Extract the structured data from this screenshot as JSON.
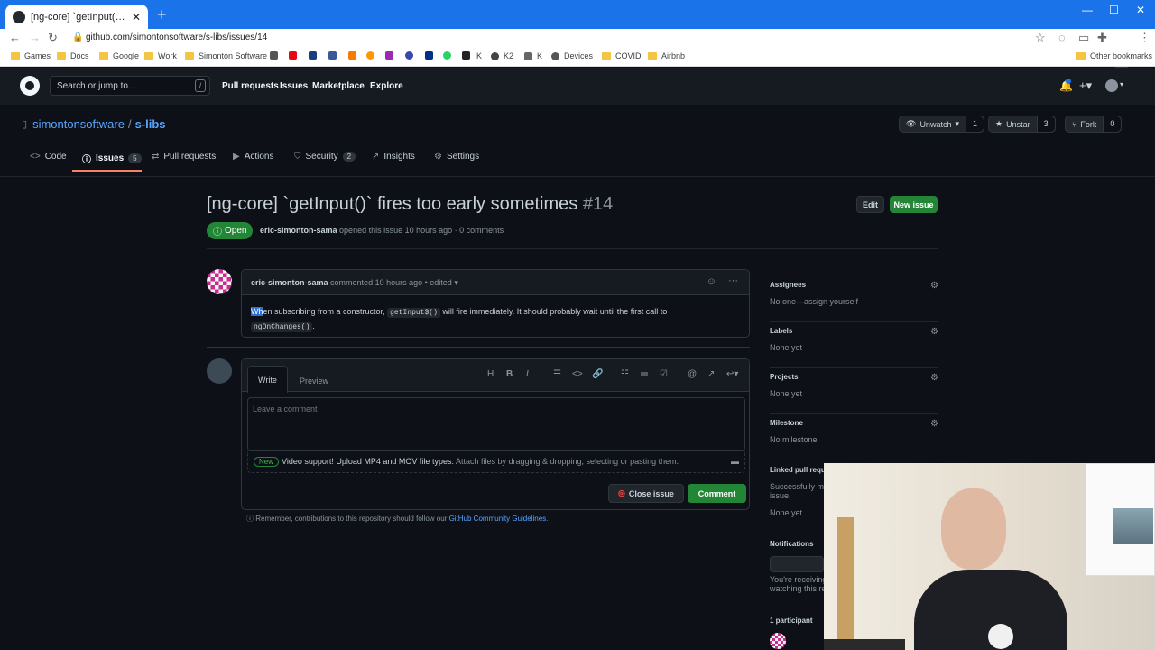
{
  "browser": {
    "tab_title": "[ng-core] `getInput()` fires too early sometimes",
    "url": "github.com/simontonsoftware/s-libs/issues/14",
    "bookmarks": [
      "Games",
      "Docs",
      "Google",
      "Work",
      "Simonton Software",
      "K2",
      "K",
      "Devices",
      "COVID",
      "Airbnb"
    ],
    "other_bookmarks": "Other bookmarks"
  },
  "header": {
    "search_placeholder": "Search or jump to...",
    "slash": "/",
    "nav": [
      "Pull requests",
      "Issues",
      "Marketplace",
      "Explore"
    ]
  },
  "repo": {
    "owner": "simontonsoftware",
    "name": "s-libs",
    "unwatch": "Unwatch",
    "watch_count": "1",
    "unstar": "Unstar",
    "star_count": "3",
    "fork": "Fork",
    "fork_count": "0",
    "tabs": [
      {
        "label": "Code",
        "count": ""
      },
      {
        "label": "Issues",
        "count": "5"
      },
      {
        "label": "Pull requests",
        "count": ""
      },
      {
        "label": "Actions",
        "count": ""
      },
      {
        "label": "Security",
        "count": "2"
      },
      {
        "label": "Insights",
        "count": ""
      },
      {
        "label": "Settings",
        "count": ""
      }
    ]
  },
  "issue": {
    "title": "[ng-core] `getInput()` fires too early sometimes",
    "number": "#14",
    "edit": "Edit",
    "new_issue": "New issue",
    "state": "Open",
    "author": "eric-simonton-sama",
    "meta": "opened this issue 10 hours ago · 0 comments"
  },
  "comment": {
    "author": "eric-simonton-sama",
    "meta": "commented 10 hours ago • edited",
    "selected": "Wh",
    "text1": "en subscribing from a constructor, ",
    "code1": "getInput$()",
    "text2": " will fire immediately. It should probably wait until the first call to",
    "code2": "ngOnChanges()",
    "text3": "."
  },
  "editor": {
    "write": "Write",
    "preview": "Preview",
    "placeholder": "Leave a comment",
    "new_badge": "New",
    "attach_bold": "Video support! Upload MP4 and MOV file types.",
    "attach_rest": " Attach files by dragging & dropping, selecting or pasting them.",
    "close_issue": "Close issue",
    "comment": "Comment"
  },
  "guidelines": {
    "text": "Remember, contributions to this repository should follow our ",
    "link": "GitHub Community Guidelines",
    "end": "."
  },
  "sidebar": {
    "assignees": {
      "title": "Assignees",
      "value": "No one—assign yourself"
    },
    "labels": {
      "title": "Labels",
      "value": "None yet"
    },
    "projects": {
      "title": "Projects",
      "value": "None yet"
    },
    "milestone": {
      "title": "Milestone",
      "value": "No milestone"
    },
    "linked": {
      "title": "Linked pull requ",
      "value": "Successfully merg",
      "value2": "issue.",
      "value3": "None yet"
    },
    "notifications": {
      "title": "Notifications",
      "value": "You're receiving",
      "value2": "watching this rep"
    },
    "participants": {
      "title": "1 participant"
    }
  },
  "colors": {
    "accent": "#238636",
    "link": "#58a6ff",
    "bg": "#0d1117",
    "chrome": "#1a73e8"
  }
}
